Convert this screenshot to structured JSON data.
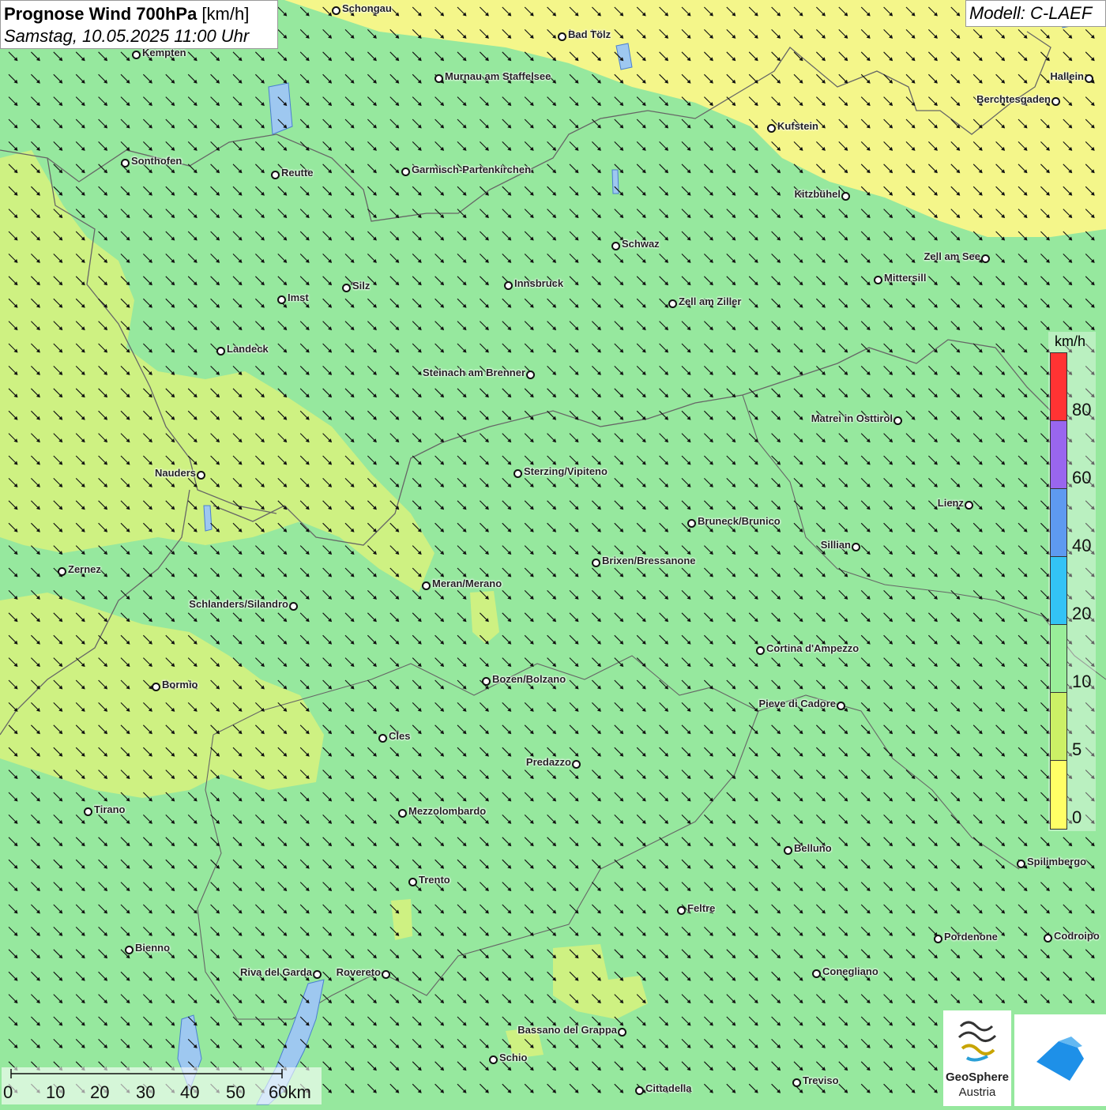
{
  "title": {
    "main_bold": "Prognose Wind 700hPa",
    "main_unit": " [km/h]",
    "datetime": "Samstag, 10.05.2025 11:00 Uhr"
  },
  "model_label": "Modell: C-LAEF",
  "legend": {
    "unit": "km/h",
    "bands": [
      {
        "color": "#ff3333"
      },
      {
        "color": "#9966ee"
      },
      {
        "color": "#5e9af0"
      },
      {
        "color": "#33c3f5"
      },
      {
        "color": "#99ee99"
      },
      {
        "color": "#ccf066"
      },
      {
        "color": "#ffff66"
      }
    ],
    "labels": [
      "80",
      "60",
      "40",
      "20",
      "10",
      "5",
      "0"
    ]
  },
  "colors": {
    "green_field": "#96e89e",
    "yellow_zone": "#f4f68a",
    "lime_zone": "#d8f27c",
    "border": "#666666",
    "arrow": "#111111"
  },
  "wind_direction": "northwest-to-southeast",
  "cities": [
    {
      "name": "Schongau"
    },
    {
      "name": "Bad Tölz"
    },
    {
      "name": "Kempten"
    },
    {
      "name": "Murnau am Staffelsee"
    },
    {
      "name": "Hallein"
    },
    {
      "name": "Berchtesgaden"
    },
    {
      "name": "Kufstein"
    },
    {
      "name": "Sonthofen"
    },
    {
      "name": "Reutte"
    },
    {
      "name": "Garmisch-Partenkirchen"
    },
    {
      "name": "Kitzbühel"
    },
    {
      "name": "Schwaz"
    },
    {
      "name": "Zell am See"
    },
    {
      "name": "Innsbruck"
    },
    {
      "name": "Mittersill"
    },
    {
      "name": "Silz"
    },
    {
      "name": "Imst"
    },
    {
      "name": "Zell am Ziller"
    },
    {
      "name": "Landeck"
    },
    {
      "name": "Steinach am Brenner"
    },
    {
      "name": "Matrei in Osttirol"
    },
    {
      "name": "Nauders"
    },
    {
      "name": "Sterzing/Vipiteno"
    },
    {
      "name": "Lienz"
    },
    {
      "name": "Bruneck/Brunico"
    },
    {
      "name": "Sillian"
    },
    {
      "name": "Brixen/Bressanone"
    },
    {
      "name": "Zernez"
    },
    {
      "name": "Meran/Merano"
    },
    {
      "name": "Schlanders/Silandro"
    },
    {
      "name": "Cortina d'Ampezzo"
    },
    {
      "name": "Bozen/Bolzano"
    },
    {
      "name": "Bormio"
    },
    {
      "name": "Pieve di Cadore"
    },
    {
      "name": "Cles"
    },
    {
      "name": "Predazzo"
    },
    {
      "name": "Tirano"
    },
    {
      "name": "Mezzolombardo"
    },
    {
      "name": "Belluno"
    },
    {
      "name": "Spilimbergo"
    },
    {
      "name": "Trento"
    },
    {
      "name": "Feltre"
    },
    {
      "name": "Bienno"
    },
    {
      "name": "Pordenone"
    },
    {
      "name": "Codroipo"
    },
    {
      "name": "Riva del Garda"
    },
    {
      "name": "Rovereto"
    },
    {
      "name": "Conegliano"
    },
    {
      "name": "Bassano del Grappa"
    },
    {
      "name": "Schio"
    },
    {
      "name": "Treviso"
    },
    {
      "name": "Cittadella"
    }
  ],
  "scale": {
    "labels": [
      "0",
      "10",
      "20",
      "30",
      "40",
      "50",
      "60km"
    ]
  },
  "logos": {
    "geosphere_line1": "GeoSphere",
    "geosphere_line2": "Austria"
  }
}
